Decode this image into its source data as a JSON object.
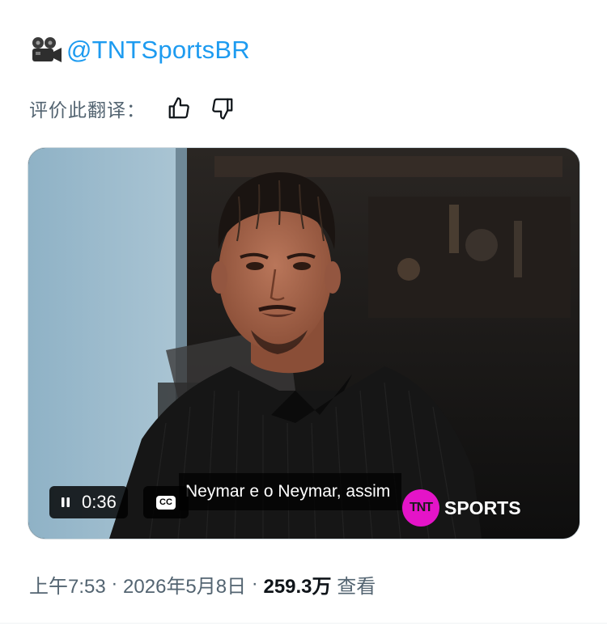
{
  "tweet": {
    "handle_emoji": "movie-camera-icon",
    "handle": "@TNTSportsBR",
    "translation_rating_label": "评价此翻译：",
    "video": {
      "elapsed_time": "0:36",
      "cc_label": "CC",
      "subtitle": "Neymar e o Neymar, assim",
      "logo_tnt": "TNT",
      "logo_sports": "SPORTS"
    },
    "meta": {
      "time": "上午7:53",
      "sep1": " · ",
      "date": "2026年5月8日",
      "sep2": " · ",
      "views_count": "259.3万",
      "views_label": " 查看"
    }
  },
  "colors": {
    "link": "#1d9bf0",
    "secondary_text": "#536471",
    "logo_magenta": "#e414c8"
  }
}
